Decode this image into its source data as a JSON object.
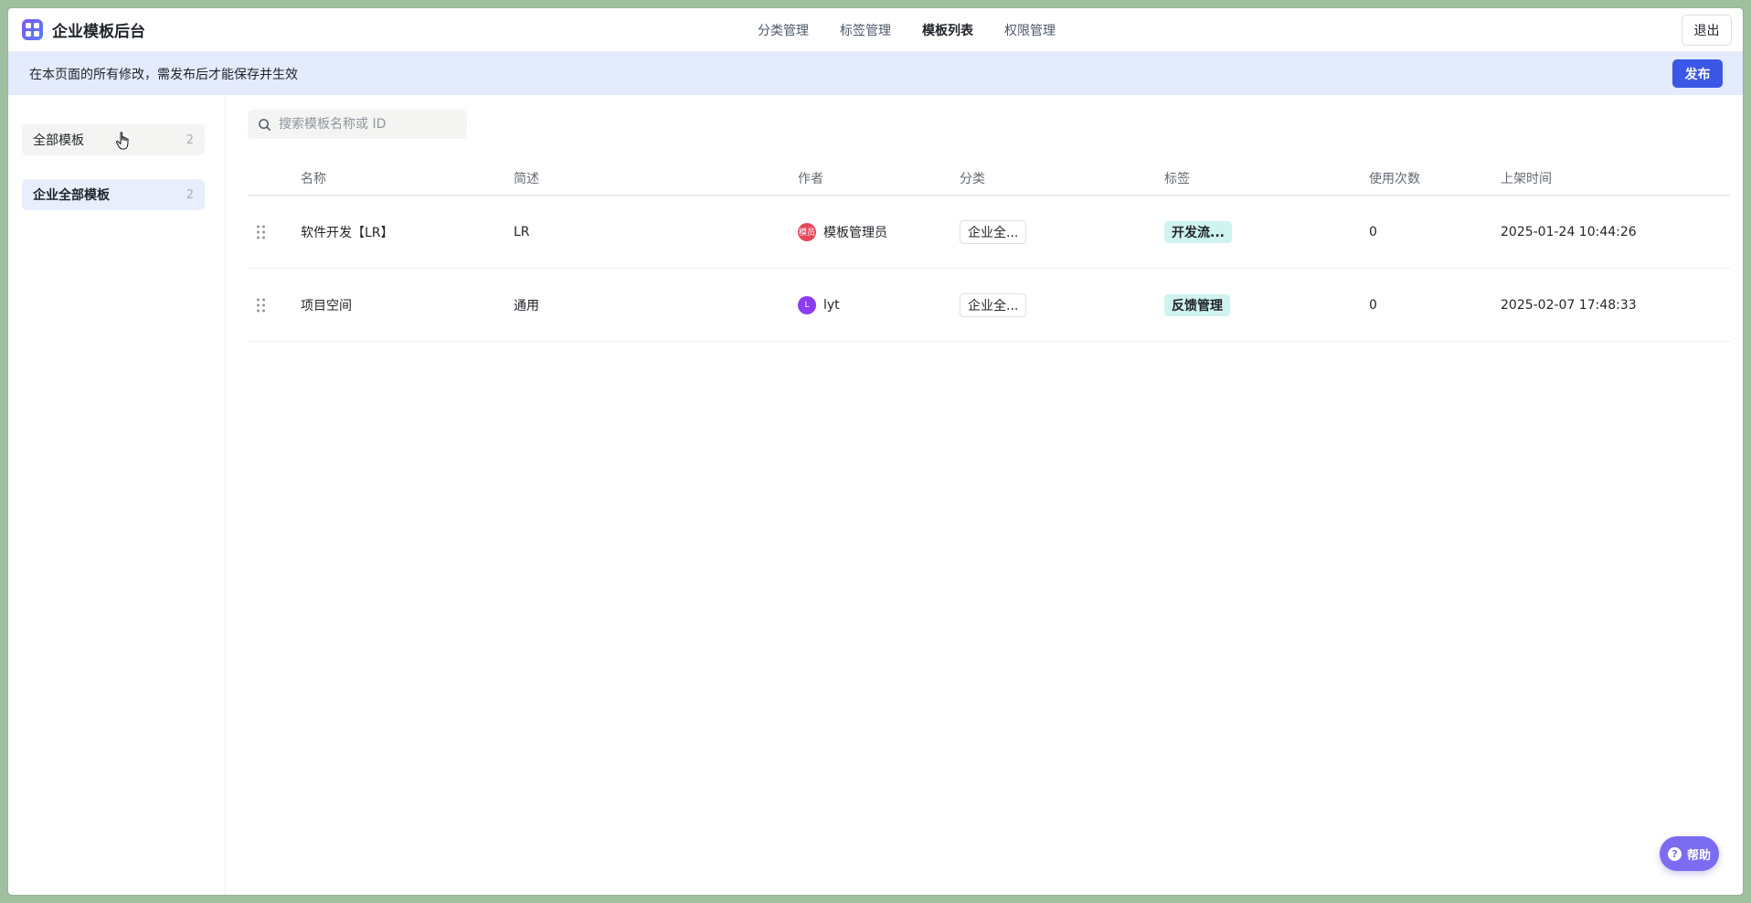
{
  "header": {
    "brand_title": "企业模板后台",
    "nav": [
      "分类管理",
      "标签管理",
      "模板列表",
      "权限管理"
    ],
    "active_nav": "模板列表",
    "logout_label": "退出"
  },
  "banner": {
    "text": "在本页面的所有修改，需发布后才能保存并生效",
    "publish_label": "发布"
  },
  "sidebar": {
    "items": [
      {
        "label": "全部模板",
        "count": "2"
      },
      {
        "label": "企业全部模板",
        "count": "2"
      }
    ]
  },
  "search": {
    "placeholder": "搜索模板名称或 ID"
  },
  "table": {
    "headers": [
      "名称",
      "简述",
      "作者",
      "分类",
      "标签",
      "使用次数",
      "上架时间"
    ],
    "rows": [
      {
        "name": "软件开发【LR】",
        "desc": "LR",
        "author": "模板管理员",
        "avatar": "模员",
        "category": "企业全...",
        "tag": "开发流...",
        "uses": "0",
        "time": "2025-01-24 10:44:26"
      },
      {
        "name": "项目空间",
        "desc": "通用",
        "author": "lyt",
        "avatar": "L",
        "category": "企业全...",
        "tag": "反馈管理",
        "uses": "0",
        "time": "2025-02-07 17:48:33"
      }
    ]
  },
  "help": {
    "label": "帮助",
    "icon_glyph": "?"
  },
  "colors": {
    "accent": "#3b57e6",
    "banner_bg": "#e3ebfd",
    "tag_bg": "#cff3ef",
    "avatar_1": "#e8465a",
    "avatar_2": "#8b3cf0",
    "help_bg": "#7b6cf2"
  }
}
